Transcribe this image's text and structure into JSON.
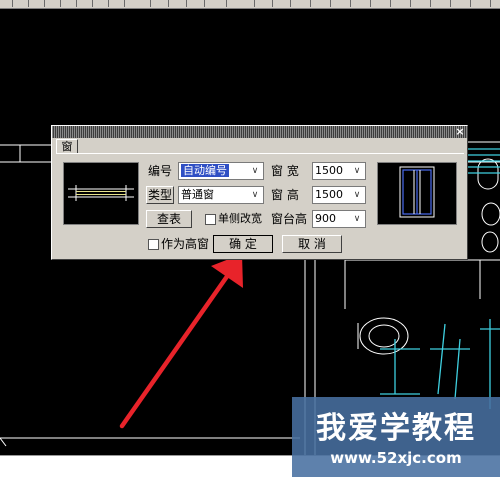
{
  "dialog": {
    "title": "",
    "close_symbol": "×",
    "tab_label": "窗",
    "number_label": "编号",
    "number_value": "自动编号",
    "type_button": "类型",
    "type_value": "普通窗",
    "lookup_button": "查表",
    "width_label": "窗 宽",
    "width_value": "1500",
    "height_label": "窗 高",
    "height_value": "1500",
    "single_side_label": "单侧改宽",
    "sill_label": "窗台高",
    "sill_value": "900",
    "high_window_label": "作为高窗",
    "ok_button": "确 定",
    "cancel_button": "取 消"
  },
  "watermark": {
    "title": "我爱学教程",
    "url": "www.52xjc.com"
  },
  "colors": {
    "canvas": "#000000",
    "dialog_bg": "#d4d0c8",
    "selection": "#2f4fc4",
    "arrow": "#e8232a",
    "cad_cyan": "#3fd0e0",
    "watermark_bg": "#4870a0"
  },
  "icons": [
    "dropdown-arrow-icon",
    "close-icon",
    "red-arrow-annotation"
  ]
}
